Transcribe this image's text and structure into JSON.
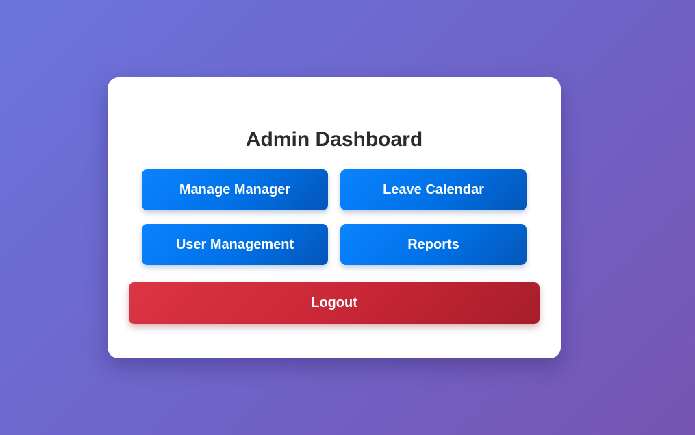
{
  "dashboard": {
    "title": "Admin Dashboard",
    "buttons": {
      "manage_manager": "Manage Manager",
      "leave_calendar": "Leave Calendar",
      "user_management": "User Management",
      "reports": "Reports",
      "logout": "Logout"
    }
  },
  "colors": {
    "background_gradient": [
      "#6a75dc",
      "#7655b3"
    ],
    "primary_button": "#0070e6",
    "logout_button": "#c82636",
    "title_text": "#2b2b2b"
  }
}
